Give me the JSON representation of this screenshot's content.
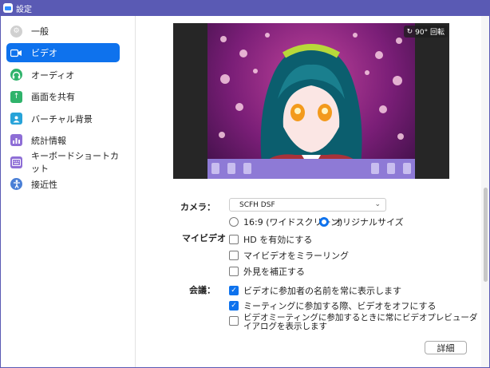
{
  "window": {
    "title": "設定"
  },
  "sidebar": {
    "items": [
      {
        "label": "一般",
        "icon": "gear-icon",
        "color": "#d0d0d0"
      },
      {
        "label": "ビデオ",
        "icon": "video-camera-icon",
        "color": "#ffffff"
      },
      {
        "label": "オーディオ",
        "icon": "headphones-icon",
        "color": "#2fb36b"
      },
      {
        "label": "画面を共有",
        "icon": "share-screen-icon",
        "color": "#2fb36b"
      },
      {
        "label": "バーチャル背景",
        "icon": "person-card-icon",
        "color": "#27a3d9"
      },
      {
        "label": "統計情報",
        "icon": "statistics-icon",
        "color": "#8e6ed6"
      },
      {
        "label": "キーボードショートカット",
        "icon": "keyboard-icon",
        "color": "#8e6ed6"
      },
      {
        "label": "接近性",
        "icon": "accessibility-icon",
        "color": "#4a7fd6"
      }
    ],
    "active_index": 1
  },
  "video": {
    "rotate_label": "90° 回転",
    "camera_label": "カメラ：",
    "camera_value": "SCFH DSF",
    "aspect_16_9": "16:9 (ワイドスクリーン)",
    "aspect_original": "オリジナルサイズ",
    "aspect_selected": "original",
    "my_video_label": "マイビデオ",
    "hd_label": "HD を有効にする",
    "mirror_label": "マイビデオをミラーリング",
    "touch_up_label": "外見を補正する",
    "meeting_label": "会議：",
    "show_names_label": "ビデオに参加者の名前を常に表示します",
    "video_off_label": "ミーティングに参加する際、ビデオをオフにする",
    "preview_dialog_label": "ビデオミーティングに参加するときに常にビデオプレビューダイアログを表示します",
    "details_button": "詳細"
  },
  "colors": {
    "accent": "#0e72ed",
    "titlebar": "#5a5ab4"
  }
}
